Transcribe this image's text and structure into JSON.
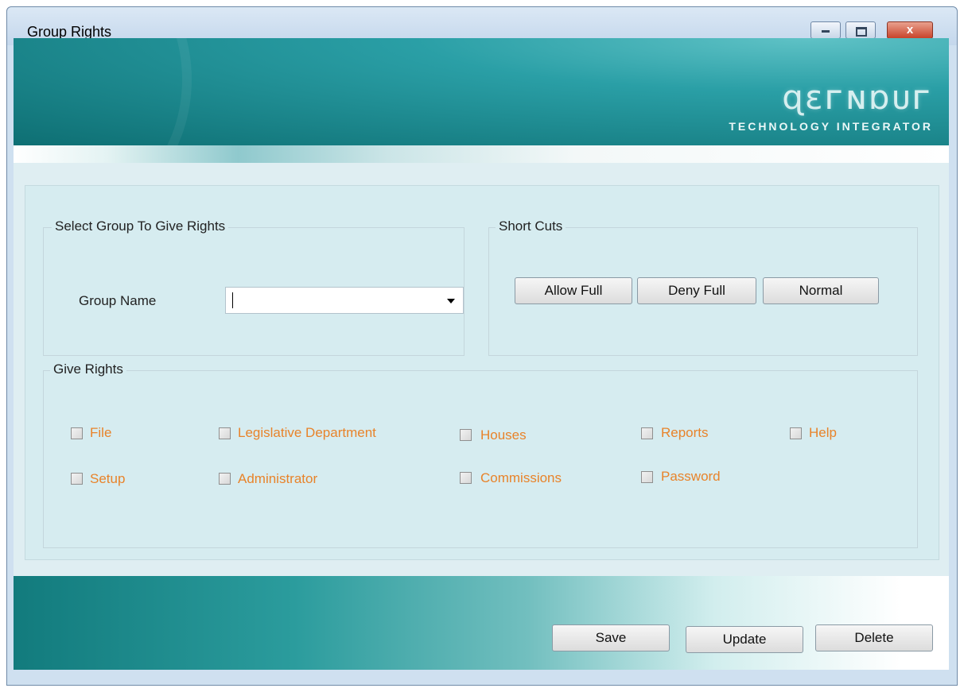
{
  "window": {
    "title": "Group Rights",
    "controls": {
      "minimize": "",
      "maximize": "",
      "close": "x"
    }
  },
  "banner": {
    "logo_text": "ɋɛᴦɴɒᴜᴦ",
    "tagline": "TECHNOLOGY INTEGRATOR"
  },
  "select_group": {
    "legend": "Select Group To Give Rights",
    "group_name_label": "Group Name",
    "group_name_value": ""
  },
  "short_cuts": {
    "legend": "Short Cuts",
    "allow_full": "Allow Full",
    "deny_full": "Deny Full",
    "normal": "Normal"
  },
  "give_rights": {
    "legend": "Give Rights",
    "items": [
      {
        "label": "File",
        "checked": false
      },
      {
        "label": "Legislative Department",
        "checked": false
      },
      {
        "label": "Houses",
        "checked": false
      },
      {
        "label": "Reports",
        "checked": false
      },
      {
        "label": "Help",
        "checked": false
      },
      {
        "label": "Setup",
        "checked": false
      },
      {
        "label": "Administrator",
        "checked": false
      },
      {
        "label": "Commissions",
        "checked": false
      },
      {
        "label": "Password",
        "checked": false
      }
    ]
  },
  "actions": {
    "save": "Save",
    "update": "Update",
    "delete": "Delete"
  },
  "colors": {
    "accent_teal": "#0e6f73",
    "rights_label": "#e8832a"
  }
}
